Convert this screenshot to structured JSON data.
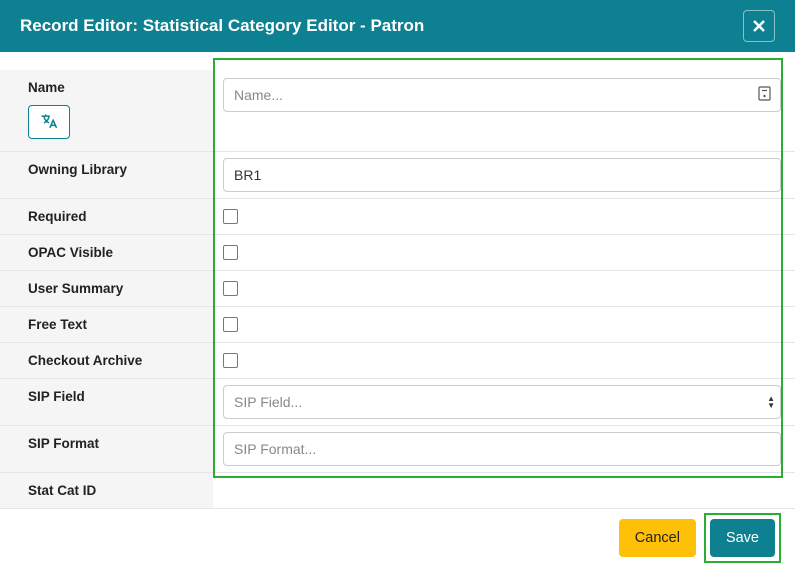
{
  "header": {
    "title": "Record Editor: Statistical Category Editor - Patron"
  },
  "fields": {
    "name": {
      "label": "Name",
      "placeholder": "Name...",
      "value": ""
    },
    "owning_library": {
      "label": "Owning Library",
      "value": "BR1"
    },
    "required": {
      "label": "Required"
    },
    "opac_visible": {
      "label": "OPAC Visible"
    },
    "user_summary": {
      "label": "User Summary"
    },
    "free_text": {
      "label": "Free Text"
    },
    "checkout_archive": {
      "label": "Checkout Archive"
    },
    "sip_field": {
      "label": "SIP Field",
      "placeholder": "SIP Field...",
      "value": ""
    },
    "sip_format": {
      "label": "SIP Format",
      "placeholder": "SIP Format...",
      "value": ""
    },
    "stat_cat_id": {
      "label": "Stat Cat ID"
    }
  },
  "buttons": {
    "cancel": "Cancel",
    "save": "Save"
  }
}
